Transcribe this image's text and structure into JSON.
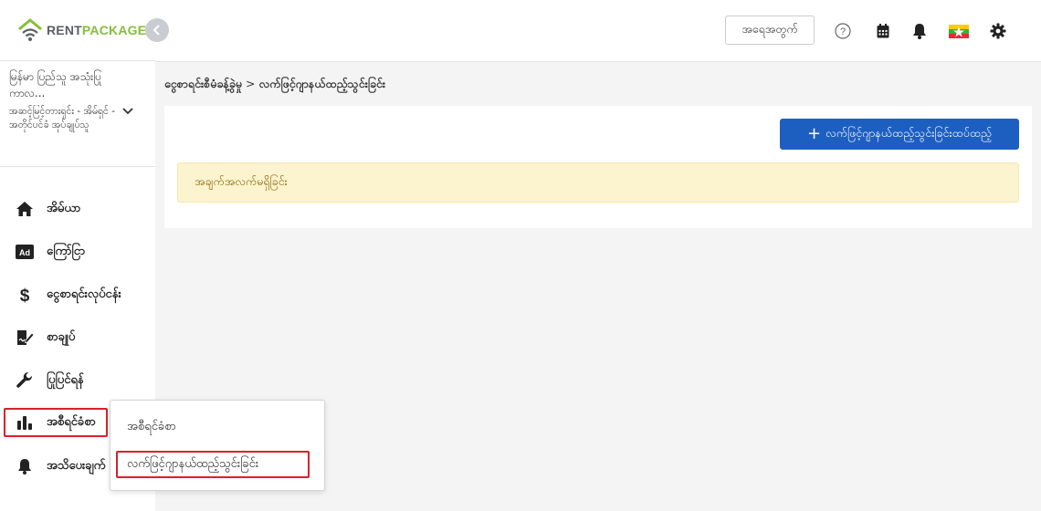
{
  "app": {
    "logo_rent": "RENT",
    "logo_package": "PACKAGE"
  },
  "user": {
    "name": "မြန်မာ ပြည်သူ အသုံးပြု ကာလ...",
    "role": "အဆင့်မြင့်တားရှင်း - အိမ်ရှင် - အတိုင်ပင်ခံ အုပ်ချုပ်သူ"
  },
  "sidebar": {
    "items": [
      {
        "label": "အိမ်ယာ",
        "icon": "home-icon"
      },
      {
        "label": "ကြော်ငြာ",
        "icon": "ad-icon"
      },
      {
        "label": "ငွေစာရင်းလုပ်ငန်း",
        "icon": "dollar-icon"
      },
      {
        "label": "စာချုပ်",
        "icon": "contract-icon"
      },
      {
        "label": "ပြုပြင်ရန်",
        "icon": "wrench-icon"
      },
      {
        "label": "အစီရင်ခံစာ",
        "icon": "bar-chart-icon"
      },
      {
        "label": "အသိပေးချက်",
        "icon": "bell-icon"
      }
    ]
  },
  "topbar": {
    "login_label": "အရေအတွက်",
    "icons": [
      "help-icon",
      "calendar-icon",
      "bell-icon",
      "flag-icon",
      "gear-icon"
    ]
  },
  "breadcrumb": {
    "parent": "ငွေစာရင်းစီမံခန့်ခွဲမှု",
    "separator": ">",
    "current": "လက်ဖြင့်ဂျာနယ်ထည့်သွင်းခြင်း"
  },
  "main": {
    "add_button_label": "လက်ဖြင့်ဂျာနယ်ထည့်သွင်းခြင်းထပ်ထည့်",
    "empty_message": "အချက်အလက်မရှိခြင်း"
  },
  "submenu": {
    "items": [
      {
        "label": "အစီရင်ခံစာ"
      },
      {
        "label": "လက်ဖြင့်ဂျာနယ်ထည့်သွင်းခြင်း"
      }
    ]
  },
  "colors": {
    "primary": "#1d5fc1",
    "logo_green": "#86bf3a",
    "alert_bg": "#fcf3cf",
    "alert_text": "#856404",
    "highlight": "#d9202e"
  }
}
